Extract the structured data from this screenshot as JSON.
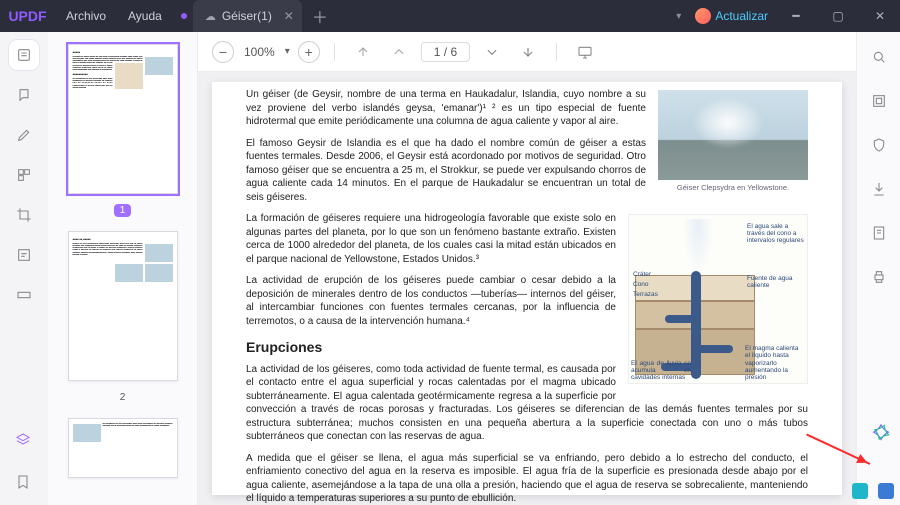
{
  "app": {
    "logo": "UPDF"
  },
  "menus": {
    "file": "Archivo",
    "help": "Ayuda"
  },
  "tab": {
    "title": "Géiser(1)"
  },
  "titlebar": {
    "upgrade": "Actualizar"
  },
  "toolbar": {
    "zoom": "100%",
    "page_current": "1",
    "page_sep": "/",
    "page_total": "6"
  },
  "thumbs": {
    "p1": "1",
    "p2": "2"
  },
  "doc": {
    "p1": "Un géiser (de Geysir, nombre de una terma en Haukadalur, Islandia, cuyo nombre a su vez proviene del verbo islandés geysa, 'emanar')¹ ² es un tipo especial de fuente hidrotermal que emite periódicamente una columna de agua caliente y vapor al aire.",
    "p2": "El famoso Geysir de Islandia es el que ha dado el nombre común de géiser a estas fuentes termales. Desde 2006, el Geysir está acordonado por motivos de seguridad. Otro famoso géiser que se encuentra a 25 m, el Strokkur, se puede ver expulsando chorros de agua caliente cada 14 minutos. En el parque de Haukadalur se encuentran un total de seis géiseres.",
    "fig1_cap": "Géiser Clepsydra en Yellowstone.",
    "p3": "La formación de géiseres requiere una hidrogeología favorable que existe solo en algunas partes del planeta, por lo que son un fenómeno bastante extraño. Existen cerca de 1000 alrededor del planeta, de los cuales casi la mitad están ubicados en el parque nacional de Yellowstone, Estados Unidos.³",
    "p4": "La actividad de erupción de los géiseres puede cambiar o cesar debido a la deposición de minerales dentro de los conductos —tuberías— internos del géiser, al intercambiar funciones con fuentes termales cercanas, por la influencia de terremotos, o a causa de la intervención humana.⁴",
    "h_erup": "Erupciones",
    "p5": "La actividad de los géiseres, como toda actividad de fuente termal, es causada por el contacto entre el agua superficial y rocas calentadas por el magma ubicado subterráneamente. El agua calentada geotérmicamente regresa a la superficie por convección a través de rocas porosas y fracturadas. Los géiseres se diferencian de las demás fuentes termales por su estructura subterránea; muchos consisten en una pequeña abertura a la superficie conectada con uno o más tubos subterráneos que conectan con las reservas de agua.",
    "p6": "A medida que el géiser se llena, el agua más superficial se va enfriando, pero debido a lo estrecho del conducto, el enfriamiento conectivo del agua en la reserva es imposible. El agua fría de la superficie es presionada desde abajo por el agua caliente, asemejándose a la tapa de una olla a presión, haciendo que el agua de reserva se sobrecaliente, manteniendo el líquido a temperaturas superiores a su punto de ebullición.",
    "ann_top": "El agua sale a través del cono a intervalos regulares",
    "ann_crater": "Cráter",
    "ann_cono": "Cono",
    "ann_terr": "Terrazas",
    "ann_fuente": "Fuente de agua caliente",
    "ann_left": "El agua de lluvia se acumula en cavidades internas",
    "ann_right": "El magma calienta el líquido hasta vaporizarlo aumentando la presión"
  }
}
